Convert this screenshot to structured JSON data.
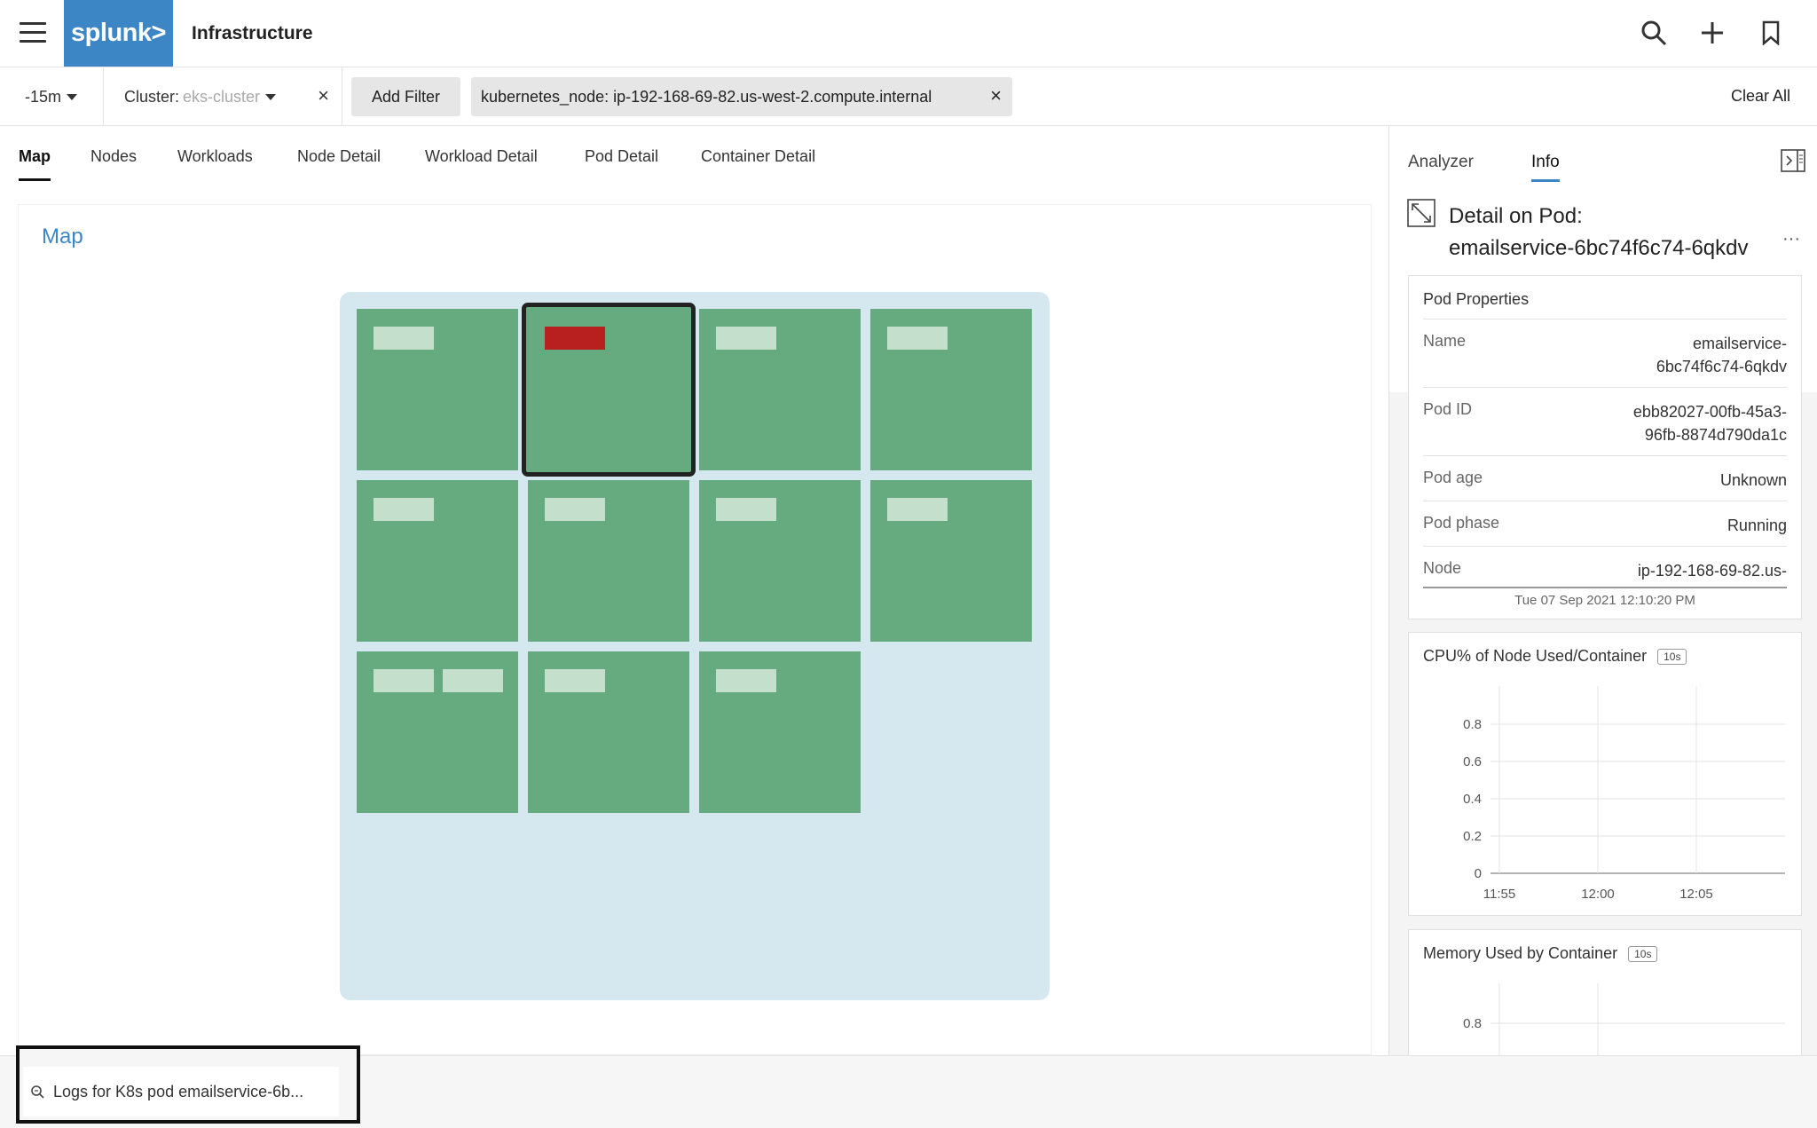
{
  "header": {
    "logo_text": "splunk>",
    "app_title": "Infrastructure",
    "icons": [
      "menu-icon",
      "search-icon",
      "plus-icon",
      "bookmark-icon"
    ]
  },
  "filters": {
    "time_range": "-15m",
    "cluster_label": "Cluster:",
    "cluster_value": "eks-cluster",
    "add_filter_label": "Add Filter",
    "active_filter": "kubernetes_node: ip-192-168-69-82.us-west-2.compute.internal",
    "clear_all_label": "Clear All"
  },
  "tabs": [
    {
      "label": "Map",
      "active": true
    },
    {
      "label": "Nodes"
    },
    {
      "label": "Workloads"
    },
    {
      "label": "Node Detail"
    },
    {
      "label": "Workload Detail"
    },
    {
      "label": "Pod Detail"
    },
    {
      "label": "Container Detail"
    }
  ],
  "map": {
    "title": "Map",
    "colors": {
      "node": "#66aa80",
      "pod": "#c5dfcd",
      "pod_alert": "#b81f1f",
      "background": "#d5e7ef"
    }
  },
  "bottom": {
    "log_item": "Logs for K8s pod emailservice-6b..."
  },
  "side_panel": {
    "tabs": [
      {
        "label": "Analyzer"
      },
      {
        "label": "Info",
        "active": true
      }
    ],
    "detail_title_line1": "Detail on Pod:",
    "detail_title_line2": "emailservice-6bc74f6c74-6qkdv",
    "more_label": "···",
    "pod_properties": {
      "title": "Pod Properties",
      "rows": [
        {
          "key": "Name",
          "value_line1": "emailservice-",
          "value_line2": "6bc74f6c74-6qkdv"
        },
        {
          "key": "Pod ID",
          "value_line1": "ebb82027-00fb-45a3-",
          "value_line2": "96fb-8874d790da1c"
        },
        {
          "key": "Pod age",
          "value_line1": "Unknown"
        },
        {
          "key": "Pod phase",
          "value_line1": "Running"
        },
        {
          "key": "Node",
          "value_line1": "ip-192-168-69-82.us-"
        }
      ],
      "timestamp": "Tue 07 Sep 2021 12:10:20 PM"
    },
    "cpu_card": {
      "title": "CPU% of Node Used/Container",
      "badge": "10s"
    },
    "mem_card": {
      "title": "Memory Used by Container",
      "badge": "10s"
    }
  },
  "chart_data": [
    {
      "type": "line",
      "title": "CPU% of Node Used/Container",
      "x": [
        "11:55",
        "12:00",
        "12:05"
      ],
      "yticks": [
        0,
        0.2,
        0.4,
        0.6,
        0.8
      ],
      "ylim": [
        0,
        0.8
      ],
      "series": [],
      "grid": true
    },
    {
      "type": "line",
      "title": "Memory Used by Container",
      "yticks": [
        0.8
      ],
      "series": [],
      "grid": true
    }
  ]
}
